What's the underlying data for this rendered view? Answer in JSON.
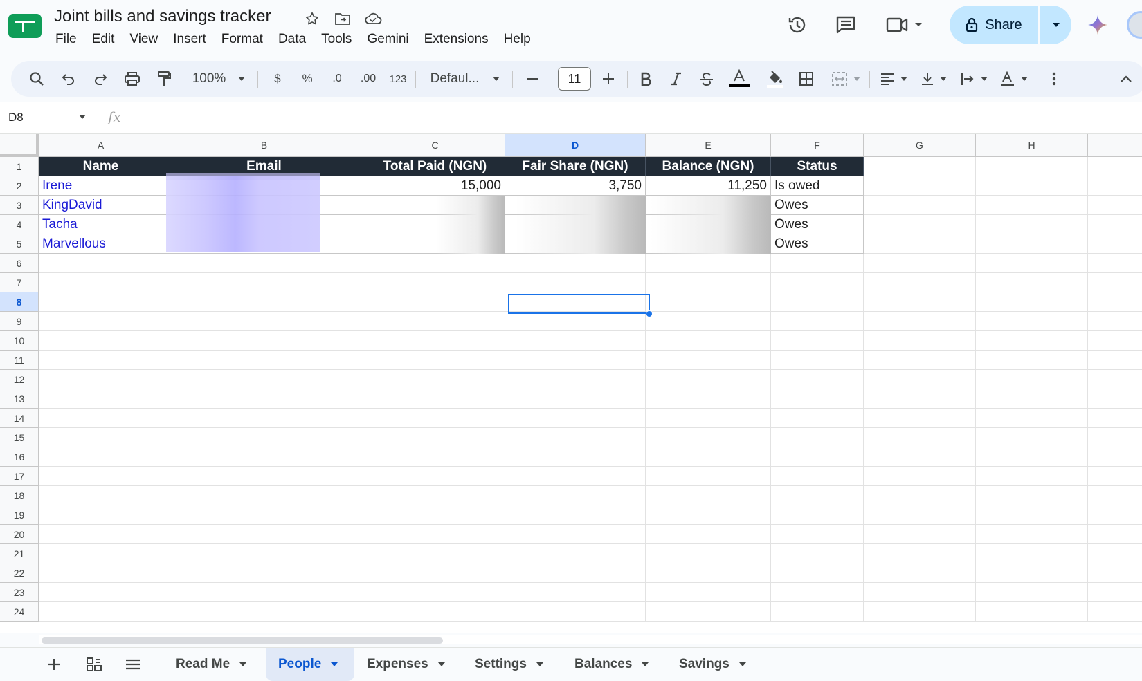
{
  "app": {
    "doc_title": "Joint bills and savings tracker",
    "menu": [
      "File",
      "Edit",
      "View",
      "Insert",
      "Format",
      "Data",
      "Tools",
      "Gemini",
      "Extensions",
      "Help"
    ],
    "share_label": "Share",
    "accent": "#c2e7ff"
  },
  "toolbar": {
    "zoom": "100%",
    "currency": "$",
    "percent": "%",
    "dec_decrease": ".0",
    "dec_increase": ".00",
    "format_123": "123",
    "font": "Defaul...",
    "font_size": "11"
  },
  "formula_bar": {
    "cell_ref": "D8",
    "fx": "fx",
    "value": ""
  },
  "grid": {
    "columns": [
      "A",
      "B",
      "C",
      "D",
      "E",
      "F",
      "G",
      "H"
    ],
    "selected_column": "D",
    "rows": [
      "1",
      "2",
      "3",
      "4",
      "5",
      "6",
      "7",
      "8",
      "9",
      "10",
      "11",
      "12",
      "13",
      "14",
      "15",
      "16",
      "17",
      "18",
      "19",
      "20",
      "21",
      "22",
      "23",
      "24"
    ],
    "selected_row": "8",
    "header_row": [
      "Name",
      "Email",
      "Total Paid (NGN)",
      "Fair Share (NGN)",
      "Balance (NGN)",
      "Status"
    ],
    "data_rows": [
      {
        "name": "Irene",
        "email": "",
        "total_paid": "15,000",
        "fair_share": "3,750",
        "balance": "11,250",
        "status": "Is owed"
      },
      {
        "name": "KingDavid",
        "email": "",
        "total_paid": "",
        "fair_share": "",
        "balance": "",
        "status": "Owes"
      },
      {
        "name": "Tacha",
        "email": "",
        "total_paid": "",
        "fair_share": "",
        "balance": "",
        "status": "Owes"
      },
      {
        "name": "Marvellous",
        "email": "",
        "total_paid": "",
        "fair_share": "",
        "balance": "",
        "status": "Owes"
      }
    ],
    "header_bg": "#212b36"
  },
  "sheet_tabs": [
    {
      "label": "Read Me",
      "active": false
    },
    {
      "label": "People",
      "active": true
    },
    {
      "label": "Expenses",
      "active": false
    },
    {
      "label": "Settings",
      "active": false
    },
    {
      "label": "Balances",
      "active": false
    },
    {
      "label": "Savings",
      "active": false
    }
  ]
}
